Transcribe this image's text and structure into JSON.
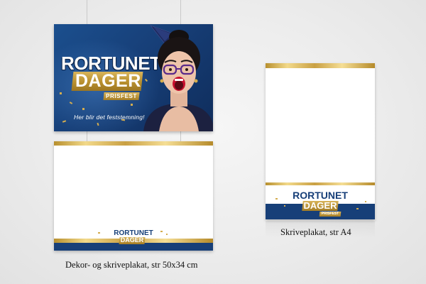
{
  "poster_large": {
    "title": "RORTUNET",
    "subtitle": "DAGER",
    "tag": "PRISFEST",
    "slogan": "Her blir det feststemning!"
  },
  "poster_small_logo": {
    "title": "RORTUNET",
    "subtitle": "DAGER",
    "tag": "PRISFEST"
  },
  "captions": {
    "left": "Dekor- og skriveplakat, str 50x34 cm",
    "right": "Skriveplakat, str A4"
  },
  "colors": {
    "navy": "#173f78",
    "gold": "#c9a043",
    "background": "#ececec"
  }
}
